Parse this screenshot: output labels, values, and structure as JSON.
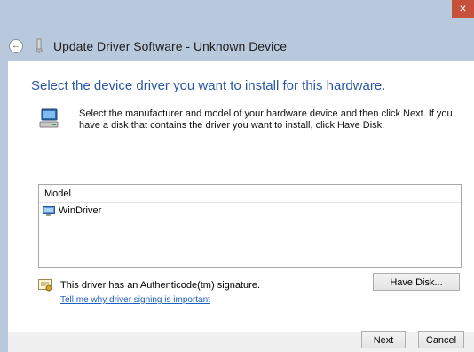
{
  "window": {
    "title": "Update Driver Software - Unknown Device",
    "close_glyph": "×",
    "back_glyph": "←",
    "accent": "#c7503a",
    "frame_color": "#b9c9dd"
  },
  "main": {
    "heading": "Select the device driver you want to install for this hardware.",
    "instructions": "Select the manufacturer and model of your hardware device and then click Next. If you have a disk that contains the driver you want to install, click Have Disk.",
    "hardware_icon": "hardware-wizard-icon",
    "heading_color": "#2a58a3"
  },
  "model_list": {
    "header": "Model",
    "items": [
      {
        "label": "WinDriver",
        "icon": "driver-device-icon"
      }
    ]
  },
  "signature": {
    "text": "This driver has an Authenticode(tm) signature.",
    "link": "Tell me why driver signing is important",
    "icon": "certificate-icon",
    "link_color": "#1b5fc2"
  },
  "buttons": {
    "have_disk": "Have Disk...",
    "next": "Next",
    "cancel": "Cancel"
  }
}
